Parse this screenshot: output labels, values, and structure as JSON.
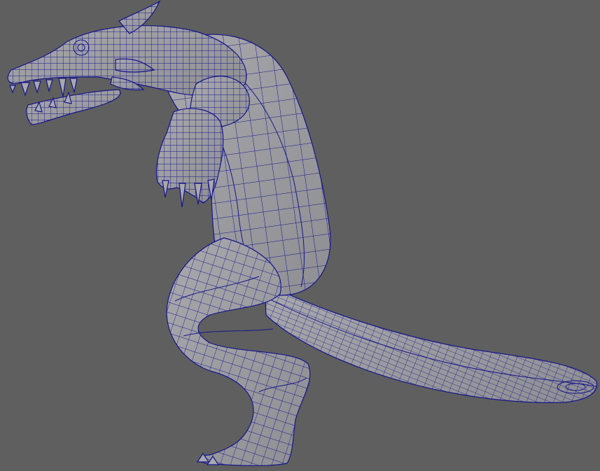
{
  "viewport": {
    "background_color": "#5f5f5f",
    "mesh_fill_color": "#a9a9ad",
    "mesh_shade_color": "#8e8e93",
    "wireframe_color": "#15158c"
  },
  "model": {
    "display_mode": "wireframe-on-shaded",
    "icon": "dinosaur-creature-mesh"
  }
}
